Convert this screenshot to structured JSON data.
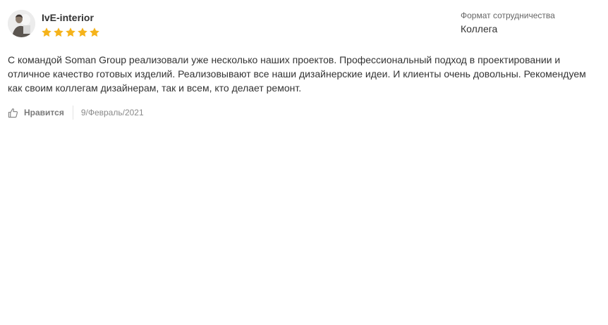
{
  "review": {
    "author_name": "IvE-interior",
    "rating": 5,
    "rating_max": 5,
    "star_color": "#f5b31b",
    "cooperation_label": "Формат сотрудничества",
    "cooperation_value": "Коллега",
    "text": "С командой Soman Group реализовали уже несколько наших проектов. Профессиональный подход в проектировании и отличное качество готовых изделий. Реализовывают все наши дизайнерские идеи. И клиенты очень довольны. Рекомендуем как своим коллегам дизайнерам, так и всем, кто делает ремонт.",
    "like_label": "Нравится",
    "like_icon": "thumbs-up-icon",
    "date": "9/Февраль/2021"
  }
}
